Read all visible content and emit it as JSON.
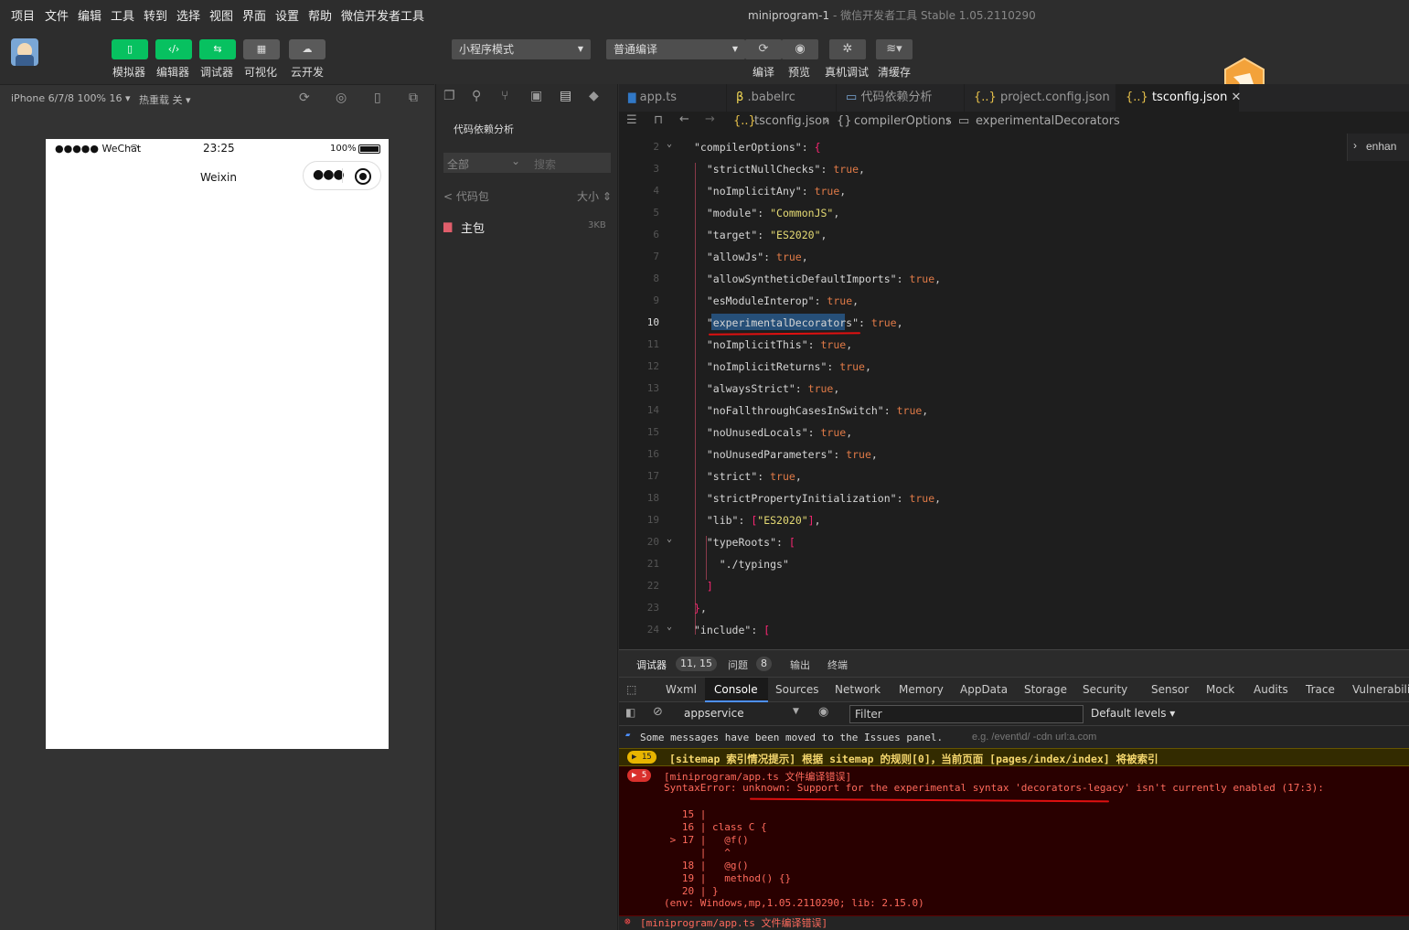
{
  "menu": [
    "项目",
    "文件",
    "编辑",
    "工具",
    "转到",
    "选择",
    "视图",
    "界面",
    "设置",
    "帮助",
    "微信开发者工具"
  ],
  "window_title": {
    "project": "miniprogram-1",
    "sep": " - ",
    "app": "微信开发者工具 Stable 1.05.2110290"
  },
  "toolbar": {
    "buttons": [
      "模拟器",
      "编辑器",
      "调试器",
      "可视化",
      "云开发"
    ],
    "mode": "小程序模式",
    "compile_mode": "普通编译",
    "actions": [
      "编译",
      "预览",
      "真机调试",
      "清缓存"
    ]
  },
  "simulator": {
    "device": "iPhone 6/7/8 100% 16 ▾",
    "hot_reload": "热重载 关 ▾",
    "status_left": "●●●●● WeChat",
    "time": "23:25",
    "battery": "100%",
    "nav_title": "Weixin"
  },
  "tree": {
    "title": "代码依赖分析",
    "filter_all": "全部",
    "search_placeholder": "搜索",
    "back": "< 代码包",
    "size_sort": "大小 ⇕",
    "pkg_name": "主包",
    "pkg_size": "3KB"
  },
  "tabs": [
    "app.ts",
    ".babelrc",
    "代码依赖分析",
    "project.config.json",
    "tsconfig.json"
  ],
  "breadcrumb": [
    "tsconfig.json",
    "compilerOptions",
    "experimentalDecorators"
  ],
  "outline_label": "enhan",
  "code": [
    {
      "n": "2",
      "t": "\"compilerOptions\": {"
    },
    {
      "n": "3",
      "t": "  \"strictNullChecks\": true,"
    },
    {
      "n": "4",
      "t": "  \"noImplicitAny\": true,"
    },
    {
      "n": "5",
      "t": "  \"module\": \"CommonJS\","
    },
    {
      "n": "6",
      "t": "  \"target\": \"ES2020\","
    },
    {
      "n": "7",
      "t": "  \"allowJs\": true,"
    },
    {
      "n": "8",
      "t": "  \"allowSyntheticDefaultImports\": true,"
    },
    {
      "n": "9",
      "t": "  \"esModuleInterop\": true,"
    },
    {
      "n": "10",
      "t": "  \"experimentalDecorators\": true,"
    },
    {
      "n": "11",
      "t": "  \"noImplicitThis\": true,"
    },
    {
      "n": "12",
      "t": "  \"noImplicitReturns\": true,"
    },
    {
      "n": "13",
      "t": "  \"alwaysStrict\": true,"
    },
    {
      "n": "14",
      "t": "  \"noFallthroughCasesInSwitch\": true,"
    },
    {
      "n": "15",
      "t": "  \"noUnusedLocals\": true,"
    },
    {
      "n": "16",
      "t": "  \"noUnusedParameters\": true,"
    },
    {
      "n": "17",
      "t": "  \"strict\": true,"
    },
    {
      "n": "18",
      "t": "  \"strictPropertyInitialization\": true,"
    },
    {
      "n": "19",
      "t": "  \"lib\": [\"ES2020\"],"
    },
    {
      "n": "20",
      "t": "  \"typeRoots\": ["
    },
    {
      "n": "21",
      "t": "    \"./typings\""
    },
    {
      "n": "22",
      "t": "  ]"
    },
    {
      "n": "23",
      "t": "},"
    },
    {
      "n": "24",
      "t": "\"include\": ["
    }
  ],
  "devtools": {
    "debugger_label": "调试器",
    "cursor_pos": "11, 15",
    "problems_label": "问题",
    "problems_count": "8",
    "output_label": "输出",
    "terminal_label": "终端",
    "tabs": [
      "Wxml",
      "Console",
      "Sources",
      "Network",
      "Memory",
      "AppData",
      "Storage",
      "Security",
      "Sensor",
      "Mock",
      "Audits",
      "Trace",
      "Vulnerability"
    ],
    "context": "appservice",
    "filter_placeholder": "Filter",
    "levels": "Default levels ▾",
    "info_msg": "Some messages have been moved to the Issues panel.",
    "filter_hint": "e.g. /event\\d/ -cdn url:a.com",
    "warn_count": "15",
    "warn_msg": "[sitemap 索引情况提示] 根据 sitemap 的规则[0]，当前页面 [pages/index/index] 将被索引",
    "err_count": "5",
    "err_title": "[miniprogram/app.ts 文件编译错误]",
    "err_msg": "SyntaxError: unknown: Support for the experimental syntax 'decorators-legacy' isn't currently enabled (17:3):",
    "err_lines": [
      "   15 |",
      "   16 | class C {",
      " > 17 |   @f()",
      "      |   ^",
      "   18 |   @g()",
      "   19 |   method() {}",
      "   20 | }"
    ],
    "err_env": "(env: Windows,mp,1.05.2110290; lib: 2.15.0)",
    "err_last": "[miniprogram/app.ts 文件编译错误]"
  }
}
